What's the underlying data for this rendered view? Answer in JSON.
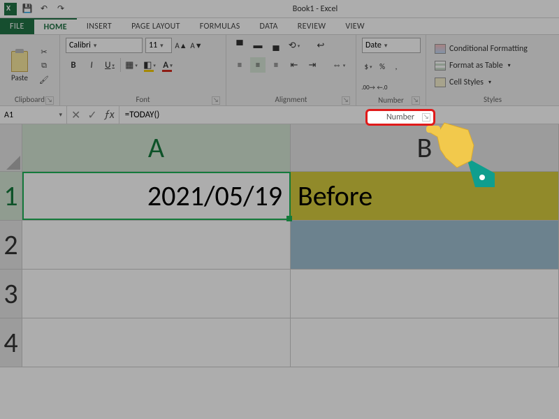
{
  "app": {
    "window_title": "Book1 - Excel"
  },
  "qat": {
    "save_icon": "save-icon",
    "undo_icon": "undo-icon",
    "redo_icon": "redo-icon"
  },
  "tabs": {
    "file": "FILE",
    "home": "HOME",
    "insert": "INSERT",
    "page_layout": "PAGE LAYOUT",
    "formulas": "FORMULAS",
    "data": "DATA",
    "review": "REVIEW",
    "view": "VIEW"
  },
  "ribbon": {
    "clipboard": {
      "label": "Clipboard",
      "paste": "Paste"
    },
    "font": {
      "label": "Font",
      "font_name": "Calibri",
      "font_size": "11",
      "bold": "B",
      "italic": "I",
      "underline": "U"
    },
    "alignment": {
      "label": "Alignment"
    },
    "number": {
      "label": "Number",
      "format_selected": "Date",
      "currency": "$",
      "percent": "%",
      "comma": ",",
      "inc_dec": "←.0",
      "dec_dec": ".00→"
    },
    "styles": {
      "label": "Styles",
      "conditional": "Conditional Formatting",
      "table": "Format as Table",
      "cell": "Cell Styles"
    }
  },
  "name_box": {
    "value": "A1"
  },
  "fx_controls": {
    "cancel": "✕",
    "enter": "✓",
    "fx": "ƒx"
  },
  "formula_bar": {
    "value": "=TODAY()"
  },
  "grid": {
    "columns": [
      "A",
      "B"
    ],
    "rows": [
      "1",
      "2",
      "3",
      "4"
    ],
    "cells": {
      "A1": "2021/05/19",
      "B1": "Before"
    }
  },
  "highlight": {
    "label": "Number"
  },
  "colors": {
    "excel_green": "#217346",
    "highlight_red": "#e01a1a",
    "b1_fill": "#d6cc3f",
    "b2_fill": "#9fc0d1"
  }
}
